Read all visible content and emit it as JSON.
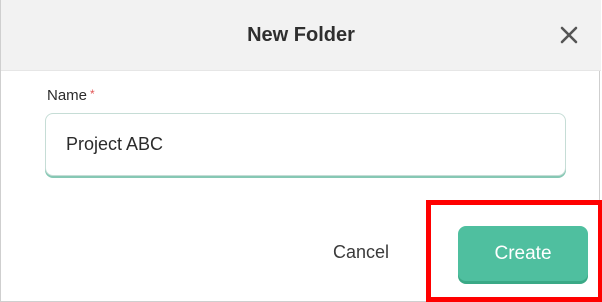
{
  "dialog": {
    "title": "New Folder",
    "close_icon": "close-icon",
    "name_label": "Name",
    "required_marker": "*",
    "name_value": "Project ABC",
    "cancel_label": "Cancel",
    "create_label": "Create"
  },
  "colors": {
    "accent": "#4fbf9f",
    "highlight": "#ff0000",
    "required": "#e25555",
    "header_bg": "#f2f2f2"
  }
}
